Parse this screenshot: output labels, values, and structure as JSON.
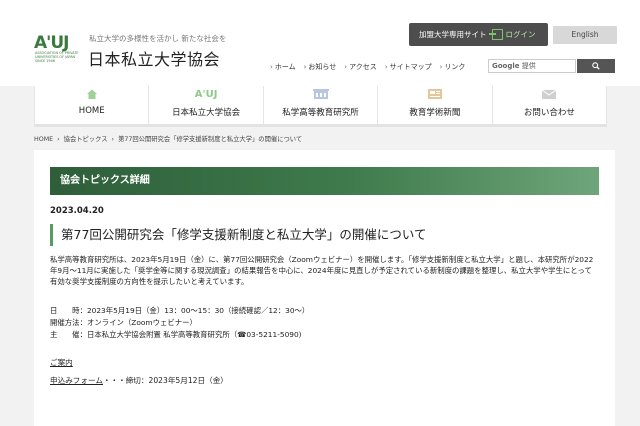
{
  "header": {
    "logo_abbr": "A'UJ",
    "logo_sub": "ASSOCIATION OF PRIVATE UNIVERSITIES OF JAPAN SINCE 1946",
    "tagline": "私立大学の多様性を活かし 新たな社会を",
    "org_name": "日本私立大学協会",
    "member_site_label": "加盟大学専用サイト",
    "login_label": "ログイン",
    "english_label": "English",
    "util_links": [
      "ホーム",
      "お知らせ",
      "アクセス",
      "サイトマップ",
      "リンク"
    ],
    "search_brand": "Google",
    "search_suffix": "提供",
    "search_button_icon": "magnifier-icon"
  },
  "nav": {
    "items": [
      {
        "label": "HOME",
        "icon": "house-icon"
      },
      {
        "label": "日本私立大学協会",
        "icon": "auj-logo-icon",
        "icon_text": "A'UJ"
      },
      {
        "label": "私学高等教育研究所",
        "icon": "building-icon"
      },
      {
        "label": "教育学術新聞",
        "icon": "newspaper-icon"
      },
      {
        "label": "お問い合わせ",
        "icon": "envelope-icon"
      }
    ]
  },
  "breadcrumb": [
    "HOME",
    "協会トピックス",
    "第77回公開研究会「修学支援新制度と私立大学」の開催について"
  ],
  "article": {
    "section_title": "協会トピックス詳細",
    "date": "2023.04.20",
    "title": "第77回公開研究会「修学支援新制度と私立大学」の開催について",
    "body": "私学高等教育研究所は、2023年5月19日（金）に、第77回公開研究会（Zoomウェビナー）を開催します。「修学支援新制度と私立大学」と題し、本研究所が2022年9月～11月に実施した「奨学金等に関する現況調査」の結果報告を中心に、2024年度に見直しが予定されている新制度の課題を整理し、私立大学や学生にとって有効な奨学支援制度の方向性を提示したいと考えています。",
    "schedule": "日　　時：2023年5月19日（金）13：00～15：30（接続確認／12：30～）",
    "method": "開催方法：オンライン（Zoomウェビナー）",
    "host": "主　　催：日本私立大学協会附置 私学高等教育研究所（☎03-5211-5090)",
    "guide_link": "ご案内",
    "form_link": "申込みフォーム",
    "form_deadline": "・・・締切：2023年5月12日（金）"
  },
  "colors": {
    "brand_green": "#3b7a3f",
    "header_gradient_start": "#2e5e3a",
    "header_gradient_end": "#6fa57a",
    "member_button": "#4d4d4d"
  }
}
